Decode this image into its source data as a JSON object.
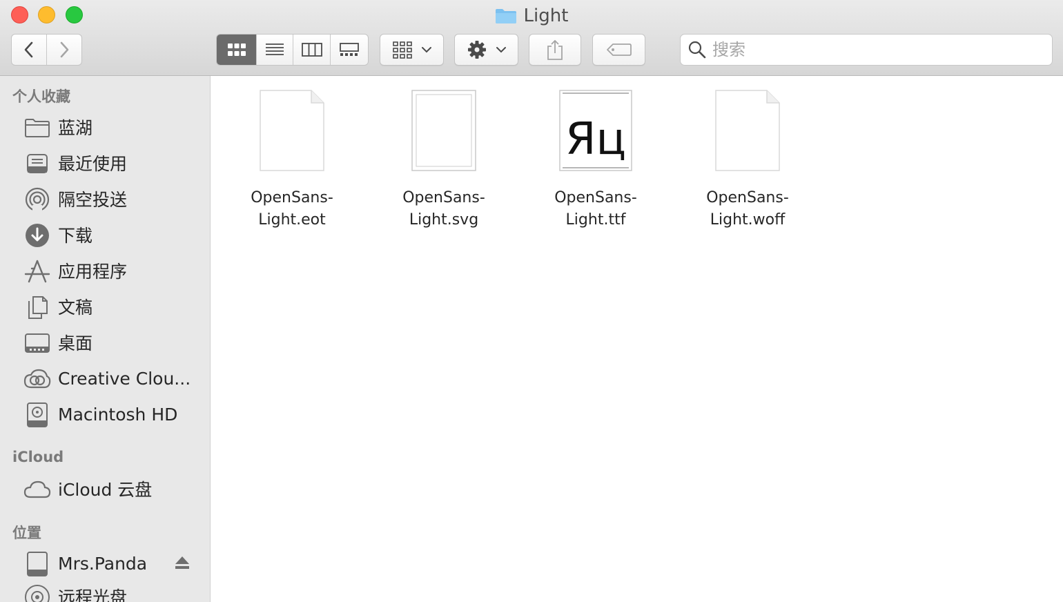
{
  "window": {
    "title": "Light"
  },
  "toolbar": {
    "nav_back": "back",
    "nav_forward": "forward",
    "view_modes": [
      "icon-view",
      "list-view",
      "column-view",
      "gallery-view"
    ],
    "search_placeholder": "搜索"
  },
  "sidebar": {
    "favorites_heading": "个人收藏",
    "favorites": [
      {
        "label": "蓝湖",
        "icon": "folder-icon"
      },
      {
        "label": "最近使用",
        "icon": "recents-icon"
      },
      {
        "label": "隔空投送",
        "icon": "airdrop-icon"
      },
      {
        "label": "下载",
        "icon": "downloads-icon"
      },
      {
        "label": "应用程序",
        "icon": "applications-icon"
      },
      {
        "label": "文稿",
        "icon": "documents-icon"
      },
      {
        "label": "桌面",
        "icon": "desktop-icon"
      },
      {
        "label": "Creative Clou...",
        "icon": "creative-cloud-icon"
      },
      {
        "label": "Macintosh HD",
        "icon": "hard-disk-icon"
      }
    ],
    "icloud_heading": "iCloud",
    "icloud": [
      {
        "label": "iCloud 云盘",
        "icon": "cloud-icon"
      }
    ],
    "locations_heading": "位置",
    "locations": [
      {
        "label": "Mrs.Panda",
        "icon": "external-disk-icon"
      },
      {
        "label": "远程光盘",
        "icon": "optical-disc-icon"
      }
    ]
  },
  "files": [
    {
      "line1": "OpenSans-",
      "line2": "Light.eot",
      "kind": "generic"
    },
    {
      "line1": "OpenSans-",
      "line2": "Light.svg",
      "kind": "svg"
    },
    {
      "line1": "OpenSans-",
      "line2": "Light.ttf",
      "kind": "font",
      "preview": "Яц"
    },
    {
      "line1": "OpenSans-",
      "line2": "Light.woff",
      "kind": "generic"
    }
  ]
}
